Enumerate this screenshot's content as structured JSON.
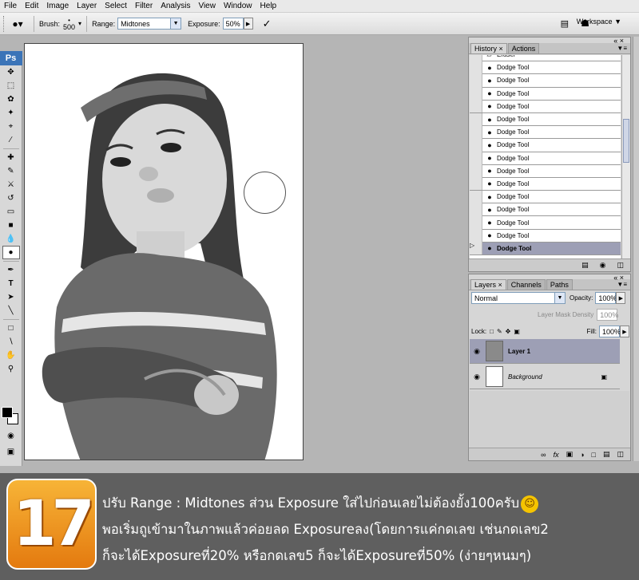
{
  "menu": [
    "File",
    "Edit",
    "Image",
    "Layer",
    "Select",
    "Filter",
    "Analysis",
    "View",
    "Window",
    "Help"
  ],
  "options": {
    "brush_label": "Brush:",
    "brush_size": "500",
    "range_label": "Range:",
    "range_value": "Midtones",
    "exposure_label": "Exposure:",
    "exposure_value": "50%",
    "workspace": "Workspace"
  },
  "toolbox": {
    "logo": "Ps"
  },
  "history_panel": {
    "tabs": [
      "History",
      "Actions"
    ],
    "items": [
      "Eraser",
      "Dodge Tool",
      "Dodge Tool",
      "Dodge Tool",
      "Dodge Tool",
      "Dodge Tool",
      "Dodge Tool",
      "Dodge Tool",
      "Dodge Tool",
      "Dodge Tool",
      "Dodge Tool",
      "Dodge Tool",
      "Dodge Tool",
      "Dodge Tool",
      "Dodge Tool",
      "Dodge Tool"
    ],
    "selected_index": 15
  },
  "layers_panel": {
    "tabs": [
      "Layers",
      "Channels",
      "Paths"
    ],
    "blend_mode": "Normal",
    "opacity_label": "Opacity:",
    "opacity_value": "100%",
    "mask_density_label": "Layer Mask Density",
    "mask_density_value": "100%",
    "lock_label": "Lock:",
    "fill_label": "Fill:",
    "fill_value": "100%",
    "layers": [
      {
        "name": "Layer 1",
        "selected": true
      },
      {
        "name": "Background",
        "selected": false
      }
    ]
  },
  "caption": {
    "step_number": "17",
    "line1": "ปรับ Range : Midtones ส่วน Exposure ใส่ไปก่อนเลยไม่ต้องยั้ง100ครับ",
    "line2": "พอเริ่มถูเข้ามาในภาพแล้วค่อยลด Exposureลง(โดยการแค่กดเลข เช่นกดเลข2",
    "line3": "ก็จะได้Exposureที่20% หรือกดเลข5 ก็จะได้Exposureที่50% (ง่ายๆหนมๆ)"
  },
  "colors": {
    "panel_selected": "#9d9fb5",
    "badge": "#f0a020",
    "caption_bg": "#5f5f5f"
  }
}
